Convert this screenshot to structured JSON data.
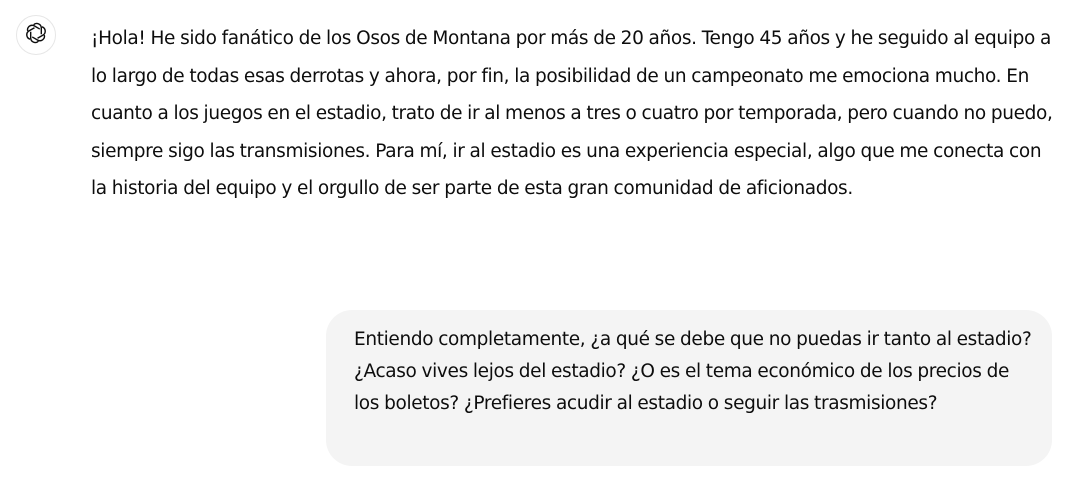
{
  "assistant_message": {
    "avatar_icon": "openai-logo-icon",
    "text": "¡Hola! He sido fanático de los Osos de Montana por más de 20 años. Tengo 45 años y he seguido al equipo a lo largo de todas esas derrotas y ahora, por fin, la posibilidad de un campeonato me emociona mucho. En cuanto a los juegos en el estadio, trato de ir al menos a tres o cuatro por temporada, pero cuando no puedo, siempre sigo las transmisiones. Para mí, ir al estadio es una experiencia especial, algo que me conecta con la historia del equipo y el orgullo de ser parte de esta gran comunidad de aficionados."
  },
  "user_message": {
    "text": "Entiendo completamente, ¿a qué se debe que no puedas ir tanto al estadio? ¿Acaso vives lejos del estadio? ¿O es el tema económico de los precios de los boletos? ¿Prefieres acudir al estadio o seguir las trasmisiones?"
  },
  "colors": {
    "text": "#0d0d0d",
    "user_bubble_bg": "#f4f4f4",
    "avatar_border": "#e6e6e6"
  }
}
